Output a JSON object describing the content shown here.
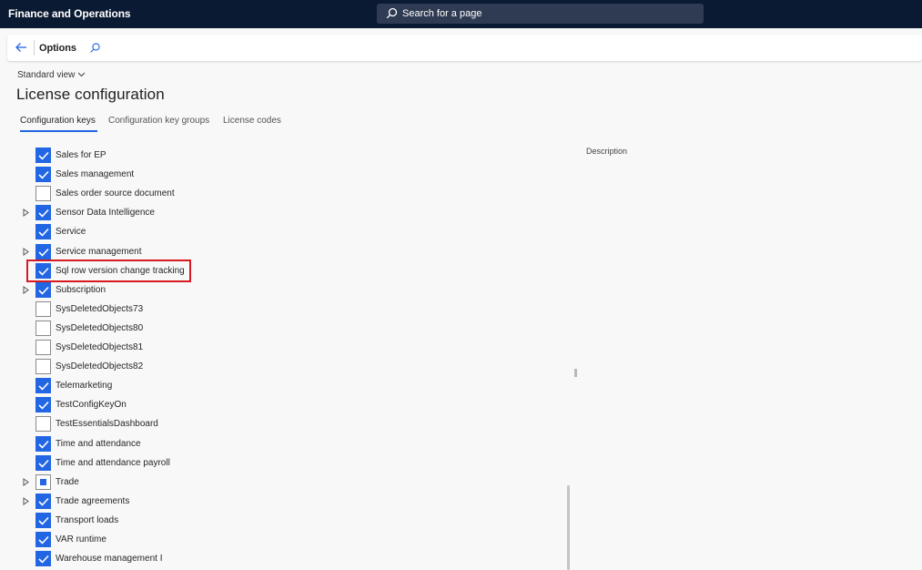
{
  "app": {
    "title": "Finance and Operations",
    "search_placeholder": "Search for a page"
  },
  "actionbar": {
    "options_label": "Options"
  },
  "page": {
    "view_selector": "Standard view",
    "title": "License configuration"
  },
  "tabs": [
    {
      "label": "Configuration keys",
      "active": true
    },
    {
      "label": "Configuration key groups",
      "active": false
    },
    {
      "label": "License codes",
      "active": false
    }
  ],
  "tree": [
    {
      "label": "Sales for EP",
      "state": "checked",
      "expandable": false
    },
    {
      "label": "Sales management",
      "state": "checked",
      "expandable": false
    },
    {
      "label": "Sales order source document",
      "state": "unchecked",
      "expandable": false
    },
    {
      "label": "Sensor Data Intelligence",
      "state": "checked",
      "expandable": true
    },
    {
      "label": "Service",
      "state": "checked",
      "expandable": false
    },
    {
      "label": "Service management",
      "state": "checked",
      "expandable": true
    },
    {
      "label": "Sql row version change tracking",
      "state": "checked",
      "expandable": false,
      "highlighted": true
    },
    {
      "label": "Subscription",
      "state": "checked",
      "expandable": true
    },
    {
      "label": "SysDeletedObjects73",
      "state": "unchecked",
      "expandable": false
    },
    {
      "label": "SysDeletedObjects80",
      "state": "unchecked",
      "expandable": false
    },
    {
      "label": "SysDeletedObjects81",
      "state": "unchecked",
      "expandable": false
    },
    {
      "label": "SysDeletedObjects82",
      "state": "unchecked",
      "expandable": false
    },
    {
      "label": "Telemarketing",
      "state": "checked",
      "expandable": false
    },
    {
      "label": "TestConfigKeyOn",
      "state": "checked",
      "expandable": false
    },
    {
      "label": "TestEssentialsDashboard",
      "state": "unchecked",
      "expandable": false
    },
    {
      "label": "Time and attendance",
      "state": "checked",
      "expandable": false
    },
    {
      "label": "Time and attendance payroll",
      "state": "checked",
      "expandable": false
    },
    {
      "label": "Trade",
      "state": "partial",
      "expandable": true
    },
    {
      "label": "Trade agreements",
      "state": "checked",
      "expandable": true
    },
    {
      "label": "Transport loads",
      "state": "checked",
      "expandable": false
    },
    {
      "label": "VAR runtime",
      "state": "checked",
      "expandable": false
    },
    {
      "label": "Warehouse management I",
      "state": "checked",
      "expandable": false
    }
  ],
  "details": {
    "description_label": "Description"
  },
  "colors": {
    "topbar": "#0b1a33",
    "accent": "#2266e3",
    "highlight": "#d71920"
  }
}
